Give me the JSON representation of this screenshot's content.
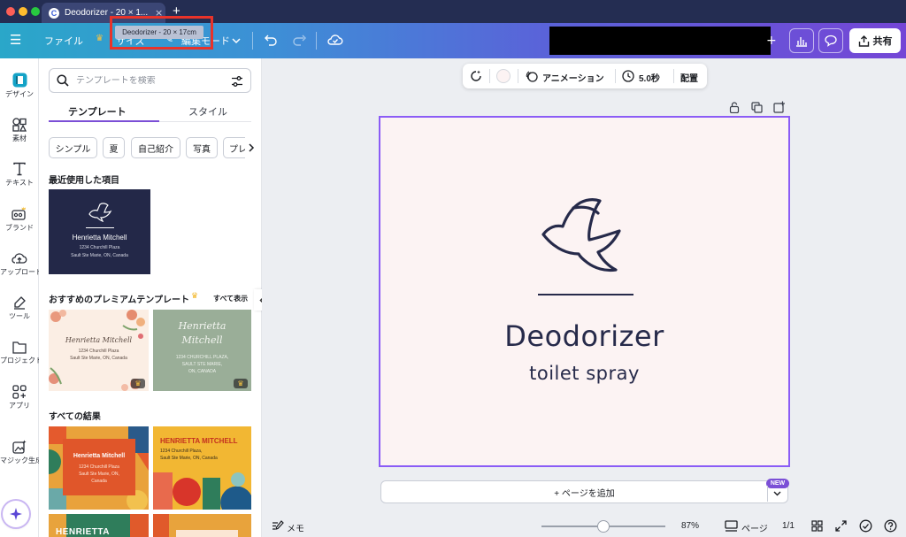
{
  "browser": {
    "tab_title": "Deodorizer - 20 × 1...",
    "tab_favicon": "C",
    "tab_close": "×",
    "new_tab": "+"
  },
  "toolbar": {
    "menu_file": "ファイル",
    "menu_resize": "サイズ",
    "menu_edit_mode": "編集モード",
    "tooltip": "Deodorizer - 20 × 17cm",
    "share_label": "共有"
  },
  "rail": [
    {
      "label": "デザイン",
      "icon": "design-icon"
    },
    {
      "label": "素材",
      "icon": "elements-icon"
    },
    {
      "label": "テキスト",
      "icon": "text-icon"
    },
    {
      "label": "ブランド",
      "icon": "brand-icon"
    },
    {
      "label": "アップロード",
      "icon": "upload-icon"
    },
    {
      "label": "ツール",
      "icon": "tools-icon"
    },
    {
      "label": "プロジェクト",
      "icon": "projects-icon"
    },
    {
      "label": "アプリ",
      "icon": "apps-icon"
    },
    {
      "label": "マジック生成",
      "icon": "magic-icon"
    }
  ],
  "panel": {
    "search_placeholder": "テンプレートを検索",
    "tab_templates": "テンプレート",
    "tab_styles": "スタイル",
    "chips": [
      "シンプル",
      "夏",
      "自己紹介",
      "写真",
      "プレ"
    ],
    "recent_title": "最近使用した項目",
    "premium_title": "おすすめのプレミアムテンプレート",
    "see_all": "すべて表示",
    "all_results_title": "すべての結果",
    "cards": {
      "recent_name": "Henrietta Mitchell",
      "recent_addr1": "1234 Churchill Plaza",
      "recent_addr2": "Sault Ste Marie, ON, Canada",
      "floral_name": "Henrietta Mitchell",
      "floral_addr1": "1234 Churchill Plaza",
      "floral_addr2": "Sault Ste Marie, ON, Canada",
      "green_name1": "Henrietta",
      "green_name2": "Mitchell",
      "green_addr1": "1234 CHURCHILL PLAZA,",
      "green_addr2": "SAULT STE MARIE,",
      "green_addr3": "ON, CANADA",
      "orange_name": "Henrietta Mitchell",
      "orange_addr1": "1234 Churchill Plaza",
      "orange_addr2": "Sault Ste Marie, ON,",
      "orange_addr3": "Canada",
      "yellow_name": "HENRIETTA MITCHELL",
      "yellow_addr1": "1234 Churchill Plaza,",
      "yellow_addr2": "Sault Ste Marie, ON, Canada",
      "green2_name": "HENRIETTA"
    }
  },
  "context_bar": {
    "animation": "アニメーション",
    "duration": "5.0秒",
    "position": "配置"
  },
  "design": {
    "title": "Deodorizer",
    "subtitle": "toilet spray",
    "colors": {
      "background": "#fcf3f3",
      "ink": "#262a4a"
    }
  },
  "canvas": {
    "add_page": "+ ページを追加",
    "new_badge": "NEW"
  },
  "bottombar": {
    "notes": "メモ",
    "zoom": "87%",
    "zoom_level": 0.5,
    "pages_label": "ページ",
    "page_count": "1/1"
  }
}
